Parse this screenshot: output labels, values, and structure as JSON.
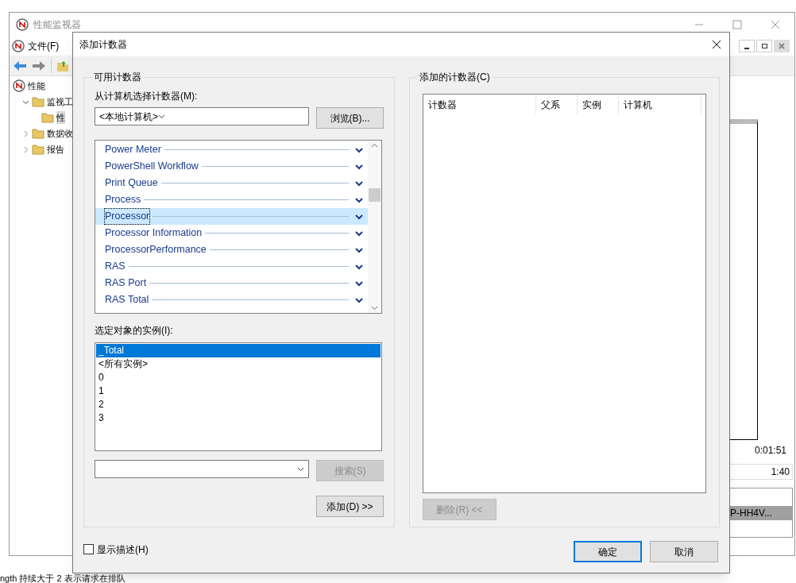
{
  "background_window": {
    "title": "性能监视器",
    "menu": [
      {
        "label": "文件(F)"
      }
    ],
    "tree": [
      {
        "label": "性能",
        "children": [
          {
            "label": "监视工",
            "expanded": true,
            "children": [
              {
                "label": "性",
                "selected": true
              }
            ]
          },
          {
            "label": "数据收",
            "expanded": false
          },
          {
            "label": "报告",
            "expanded": false
          }
        ]
      }
    ],
    "graph": {
      "time": "0:01:51",
      "duration": "1:40",
      "legend_item": "P-HH4V..."
    },
    "status_text": "ngth 持续大于 2 表示请求在排队"
  },
  "dialog": {
    "title": "添加计数器",
    "available": {
      "title": "可用计数器",
      "computer_label": "从计算机选择计数器(M):",
      "computer": "<本地计算机>",
      "browse_button": "浏览(B)...",
      "counters": [
        {
          "label": "Power Meter",
          "selected": false
        },
        {
          "label": "PowerShell Workflow",
          "selected": false
        },
        {
          "label": "Print Queue",
          "selected": false
        },
        {
          "label": "Process",
          "selected": false
        },
        {
          "label": "Processor",
          "selected": true
        },
        {
          "label": "Processor Information",
          "selected": false
        },
        {
          "label": "ProcessorPerformance",
          "selected": false
        },
        {
          "label": "RAS",
          "selected": false
        },
        {
          "label": "RAS Port",
          "selected": false
        },
        {
          "label": "RAS Total",
          "selected": false
        }
      ],
      "instances_label": "选定对象的实例(I):",
      "instances": [
        {
          "label": "_Total",
          "selected": true
        },
        {
          "label": "<所有实例>",
          "selected": false
        },
        {
          "label": "0",
          "selected": false
        },
        {
          "label": "1",
          "selected": false
        },
        {
          "label": "2",
          "selected": false
        },
        {
          "label": "3",
          "selected": false
        }
      ],
      "search_button": {
        "label": "搜索(S)",
        "disabled": true
      },
      "add_button": "添加(D) >>"
    },
    "added": {
      "title": "添加的计数器(C)",
      "columns": [
        "计数器",
        "父系",
        "实例",
        "计算机"
      ],
      "remove_button": {
        "label": "删除(R) <<",
        "disabled": true
      }
    },
    "show_description": {
      "label": "显示描述(H)",
      "checked": false
    },
    "buttons": [
      {
        "label": "确定",
        "default": true
      },
      {
        "label": "取消",
        "default": false
      }
    ]
  }
}
